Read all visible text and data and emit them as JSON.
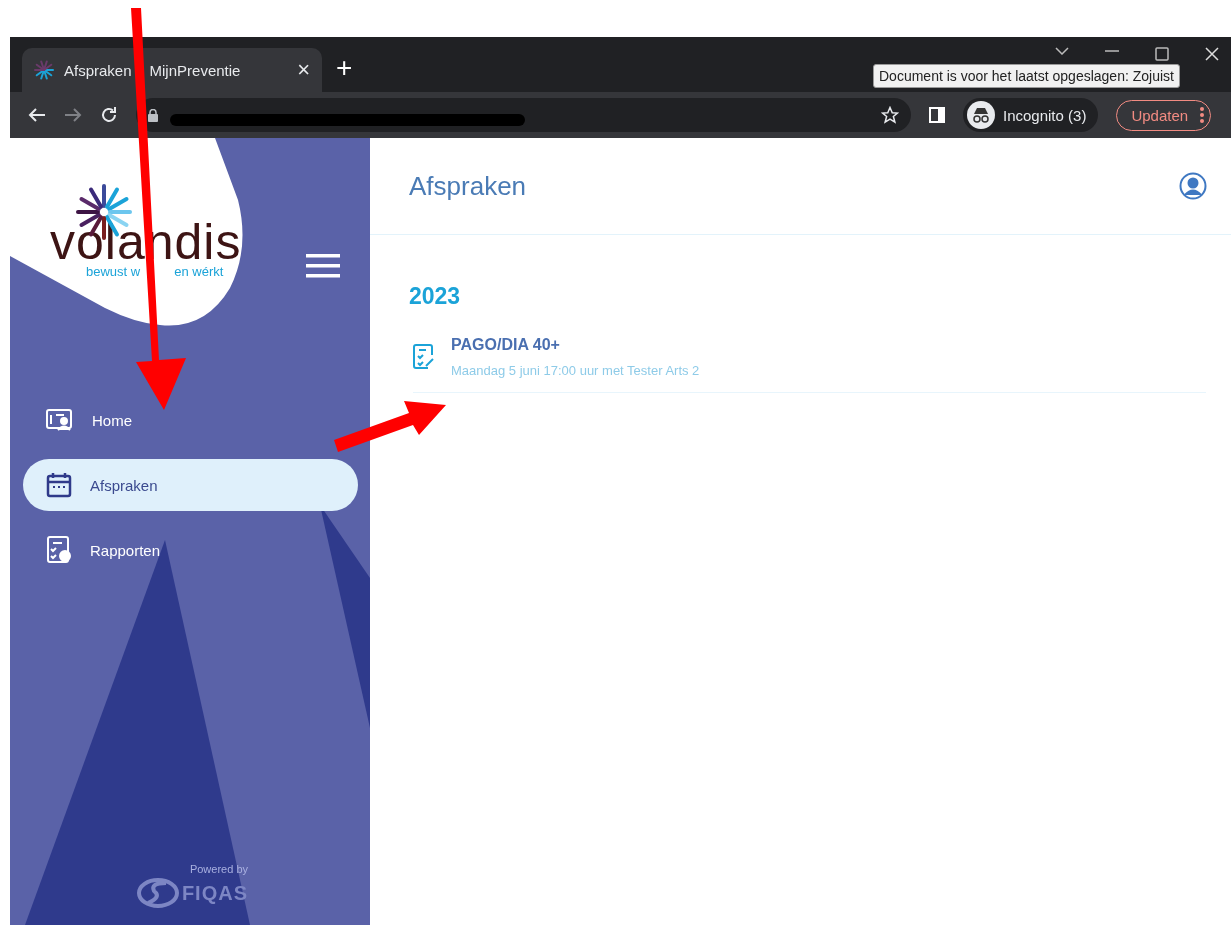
{
  "browser": {
    "tabs": [
      {
        "title_parts": [
          "Afspraken",
          "MijnPreventie"
        ],
        "close": "×",
        "selected": true
      }
    ],
    "new_tab": "+",
    "profile": "Incognito (3)",
    "update_button": "Updaten",
    "tooltip": "Document is voor het laatst opgeslagen: Zojuist"
  },
  "sidebar": {
    "logo": {
      "wordmark": "volandis",
      "tagline_parts": [
        "bewust w",
        "en wérkt"
      ]
    },
    "nav_items": [
      {
        "label": "Home",
        "selected": false
      },
      {
        "label": "Afspraken",
        "selected": true
      },
      {
        "label": "Rapporten",
        "selected": false
      }
    ],
    "footer": {
      "powered_by": "Powered by",
      "brand": "FIQAS"
    }
  },
  "main": {
    "title": "Afspraken",
    "groups": [
      {
        "year": "2023",
        "appointments": [
          {
            "title": "PAGO/DIA 40+",
            "subtitle": "Maandag 5 juni 17:00 uur met Tester Arts 2"
          }
        ]
      }
    ]
  }
}
